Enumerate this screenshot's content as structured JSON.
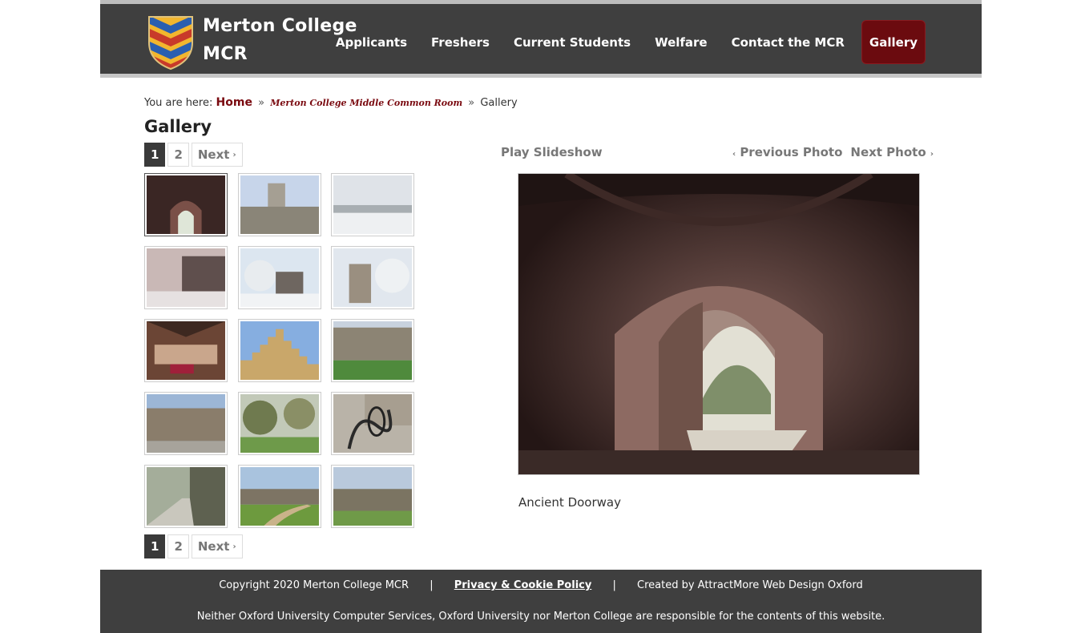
{
  "header": {
    "title_line1": "Merton College",
    "title_line2": "MCR",
    "nav": [
      {
        "label": "Applicants"
      },
      {
        "label": "Freshers"
      },
      {
        "label": "Current Students"
      },
      {
        "label": "Welfare"
      },
      {
        "label": "Contact the MCR"
      },
      {
        "label": "Gallery",
        "active": true
      }
    ],
    "colors": {
      "bar": "#3f3f3f",
      "accent": "#6b0b0f"
    }
  },
  "breadcrumb": {
    "prefix": "You are here:",
    "home": "Home",
    "separator": "»",
    "parent": "Merton College Middle Common Room",
    "current": "Gallery"
  },
  "page_title": "Gallery",
  "pagination": {
    "pages": [
      "1",
      "2"
    ],
    "current": "1",
    "next": "Next",
    "next_arrow": "›"
  },
  "thumbnails": [
    {
      "subject": "ancient doorway",
      "selected": true
    },
    {
      "subject": "chapel tower quad"
    },
    {
      "subject": "snowy meadow"
    },
    {
      "subject": "snowy gate"
    },
    {
      "subject": "snowy trees and building"
    },
    {
      "subject": "snowy tower"
    },
    {
      "subject": "hall interior"
    },
    {
      "subject": "stepped gable with clock"
    },
    {
      "subject": "quad lawn"
    },
    {
      "subject": "quad buildings"
    },
    {
      "subject": "garden trees"
    },
    {
      "subject": "iron gate detail"
    },
    {
      "subject": "iron fence path"
    },
    {
      "subject": "garden path"
    },
    {
      "subject": "long building"
    }
  ],
  "viewer": {
    "play": "Play Slideshow",
    "prev": "Previous Photo",
    "prev_arrow": "‹",
    "next": "Next Photo",
    "next_arrow": "›",
    "caption": "Ancient Doorway"
  },
  "footer": {
    "copyright": "Copyright 2020 Merton College MCR",
    "divider": "|",
    "policy": "Privacy & Cookie Policy",
    "credit": "Created by AttractMore Web Design Oxford",
    "disclaimer": "Neither Oxford University Computer Services, Oxford University nor Merton College are responsible for the contents of this website."
  }
}
